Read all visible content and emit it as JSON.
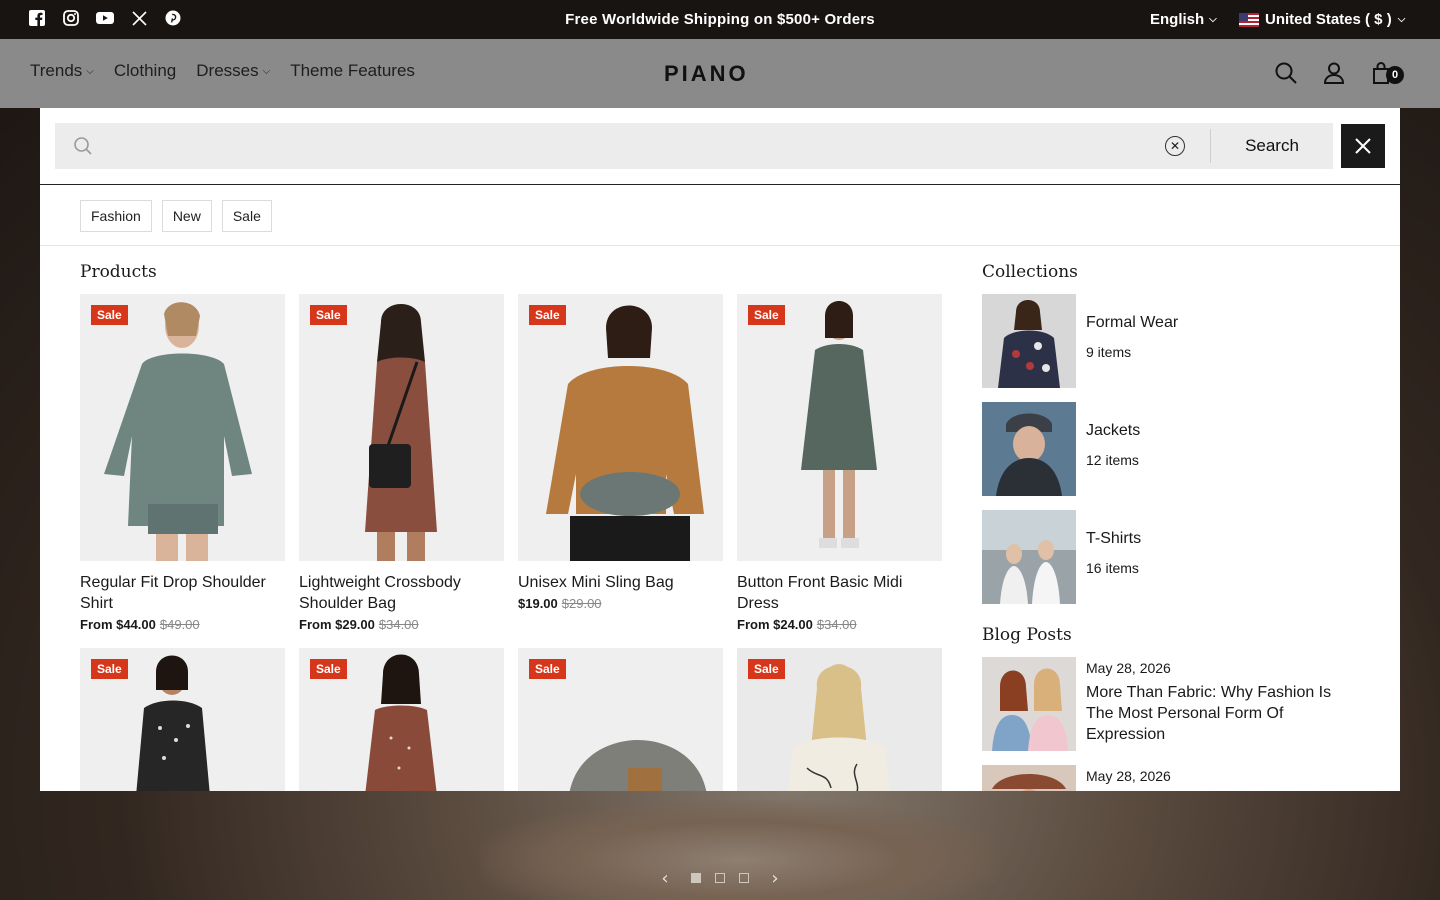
{
  "announcement": {
    "text": "Free Worldwide Shipping on $500+ Orders",
    "language": "English",
    "country": "United States ( $ )",
    "social": [
      "facebook-icon",
      "instagram-icon",
      "youtube-icon",
      "x-icon",
      "pinterest-icon"
    ]
  },
  "header": {
    "logo": "PIANO",
    "nav": [
      {
        "label": "Trends",
        "has_dropdown": true
      },
      {
        "label": "Clothing",
        "has_dropdown": false
      },
      {
        "label": "Dresses",
        "has_dropdown": true
      },
      {
        "label": "Theme Features",
        "has_dropdown": false
      }
    ],
    "cart_count": "0"
  },
  "search": {
    "value": "",
    "placeholder": "",
    "button_label": "Search",
    "tags": [
      "Fashion",
      "New",
      "Sale"
    ]
  },
  "sections": {
    "products": "Products",
    "collections": "Collections",
    "blog": "Blog Posts"
  },
  "products": [
    {
      "badge": "Sale",
      "title": "Regular Fit Drop Shoulder Shirt",
      "price": "From $44.00",
      "old_price": "$49.00"
    },
    {
      "badge": "Sale",
      "title": "Lightweight Crossbody Shoulder Bag",
      "price": "From $29.00",
      "old_price": "$34.00"
    },
    {
      "badge": "Sale",
      "title": "Unisex Mini Sling Bag",
      "price": "$19.00",
      "old_price": "$29.00"
    },
    {
      "badge": "Sale",
      "title": "Button Front Basic Midi Dress",
      "price": "From $24.00",
      "old_price": "$34.00"
    },
    {
      "badge": "Sale",
      "title": "",
      "price": "",
      "old_price": ""
    },
    {
      "badge": "Sale",
      "title": "",
      "price": "",
      "old_price": ""
    },
    {
      "badge": "Sale",
      "title": "",
      "price": "",
      "old_price": ""
    },
    {
      "badge": "Sale",
      "title": "",
      "price": "",
      "old_price": ""
    }
  ],
  "collections": [
    {
      "name": "Formal Wear",
      "count": "9 items"
    },
    {
      "name": "Jackets",
      "count": "12 items"
    },
    {
      "name": "T-Shirts",
      "count": "16 items"
    }
  ],
  "blog_posts": [
    {
      "date": "May 28, 2026",
      "title": "More Than Fabric: Why Fashion Is The Most Personal Form Of Expression"
    },
    {
      "date": "May 28, 2026",
      "title": ""
    }
  ],
  "colors": {
    "announcement_bg": "#181412",
    "sale_badge": "#d6371b",
    "close_button_bg": "#1a1a1a"
  }
}
